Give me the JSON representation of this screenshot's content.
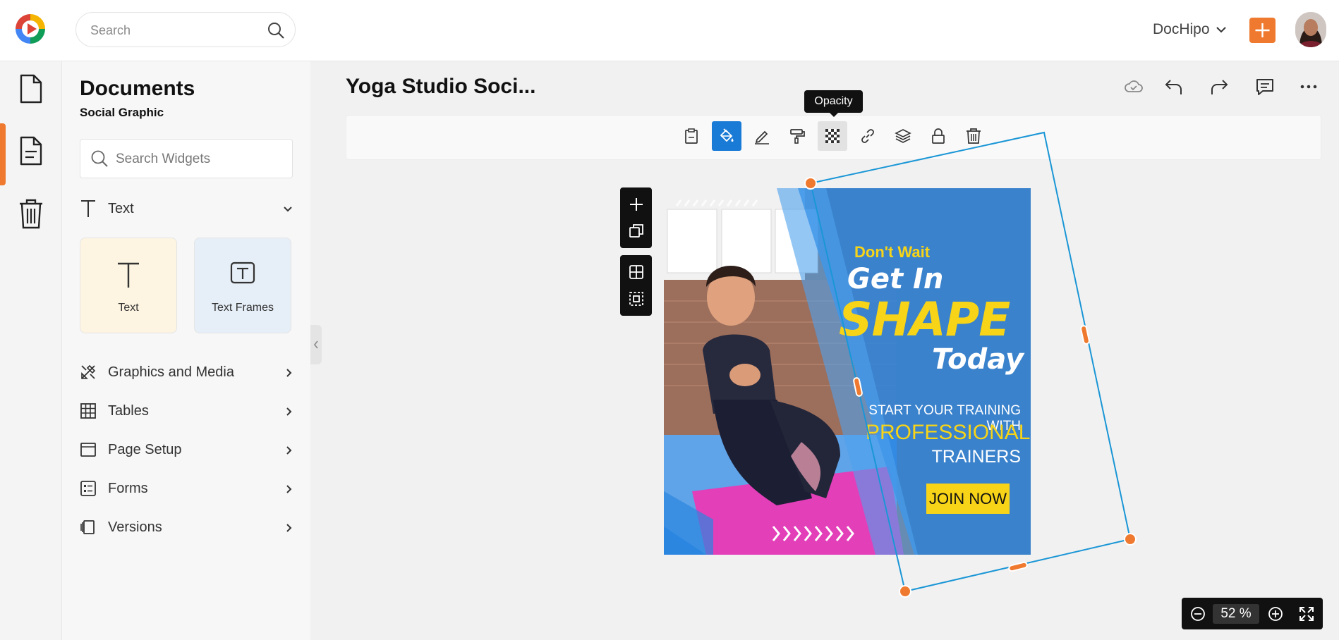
{
  "header": {
    "search_placeholder": "Search",
    "brand_label": "DocHipo",
    "add_label": "+",
    "accent_color": "#ef7a2f"
  },
  "rail": {
    "items": [
      "documents-icon",
      "document-page-icon",
      "trash-icon"
    ]
  },
  "panel": {
    "title": "Documents",
    "subtitle": "Social Graphic",
    "widget_search_placeholder": "Search Widgets",
    "text_section": "Text",
    "cards": [
      {
        "label": "Text"
      },
      {
        "label": "Text Frames"
      }
    ],
    "nav": [
      {
        "label": "Graphics and Media",
        "icon": "graphics-icon"
      },
      {
        "label": "Tables",
        "icon": "table-icon"
      },
      {
        "label": "Page Setup",
        "icon": "page-setup-icon"
      },
      {
        "label": "Forms",
        "icon": "forms-icon"
      },
      {
        "label": "Versions",
        "icon": "versions-icon"
      }
    ]
  },
  "document": {
    "title": "Yoga Studio Soci..."
  },
  "toolbar": {
    "tooltip": "Opacity",
    "active_color": "#1a7bd6"
  },
  "design": {
    "dont_wait": "Don't Wait",
    "get_in": "Get In",
    "shape": "SHAPE",
    "today": "Today",
    "line1": "START YOUR TRAINING WITH",
    "line2": "PROFESSIONAL",
    "line3": "TRAINERS",
    "cta": "JOIN NOW",
    "yellow": "#f7d417",
    "blue": "#2b86e0"
  },
  "zoom": {
    "value": "52",
    "unit": "%"
  }
}
